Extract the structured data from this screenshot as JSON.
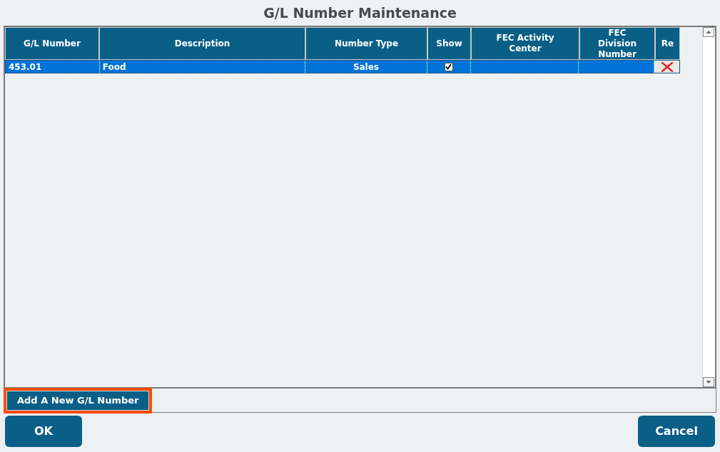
{
  "window": {
    "title": "G/L Number Maintenance"
  },
  "table": {
    "columns": [
      {
        "label": "G/L Number"
      },
      {
        "label": "Description"
      },
      {
        "label": "Number Type"
      },
      {
        "label": "Show"
      },
      {
        "label": "FEC Activity Center"
      },
      {
        "label": "FEC Division Number"
      },
      {
        "label": "Re"
      }
    ],
    "rows": [
      {
        "selected": true,
        "gl_number": "453.01",
        "description": "Food",
        "number_type": "Sales",
        "show": true
      }
    ]
  },
  "add_button": {
    "label": "Add A New G/L Number",
    "highlighted": true
  },
  "buttons": [
    {
      "label": "OK"
    },
    {
      "label": "Cancel"
    }
  ]
}
